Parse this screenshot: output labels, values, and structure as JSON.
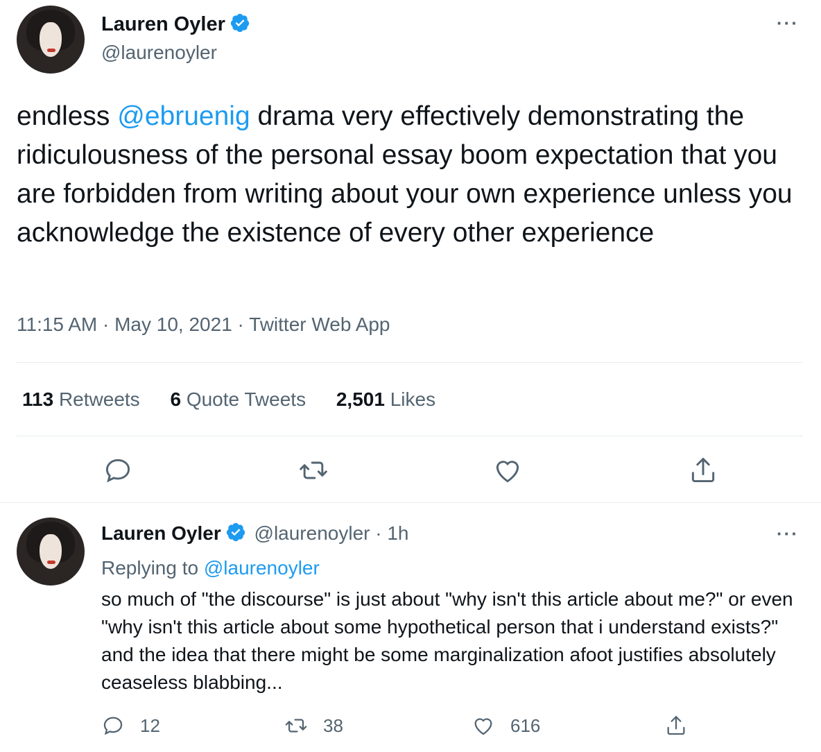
{
  "main_tweet": {
    "author_name": "Lauren Oyler",
    "handle": "@laurenoyler",
    "text_before": "endless ",
    "mention": "@ebruenig",
    "text_after": " drama very effectively demonstrating the ridiculousness of the personal essay boom expectation that you are forbidden from writing about your own experience unless you acknowledge the existence of every other experience",
    "timestamp": "11:15 AM · May 10, 2021 · Twitter Web App",
    "stats": {
      "retweets_count": "113",
      "retweets_label": "Retweets",
      "quotes_count": "6",
      "quotes_label": "Quote Tweets",
      "likes_count": "2,501",
      "likes_label": "Likes"
    },
    "actions": [
      "reply-icon",
      "retweet-icon",
      "like-icon",
      "share-icon"
    ]
  },
  "reply_tweet": {
    "author_name": "Lauren Oyler",
    "handle_time": "@laurenoyler · 1h",
    "replying_prefix": "Replying to",
    "replying_handle": "@laurenoyler",
    "text": "so much of \"the discourse\" is just about \"why isn't this article about me?\" or even \"why isn't this article about some hypothetical person that i understand exists?\" and the idea that there might be some marginalization afoot justifies absolutely ceaseless blabbing...",
    "reply_count": "12",
    "retweet_count": "38",
    "like_count": "616"
  },
  "colors": {
    "accent": "#1d9bf0",
    "secondary_text": "#536471",
    "primary_text": "#0f1419",
    "divider": "#e6ecf0"
  }
}
